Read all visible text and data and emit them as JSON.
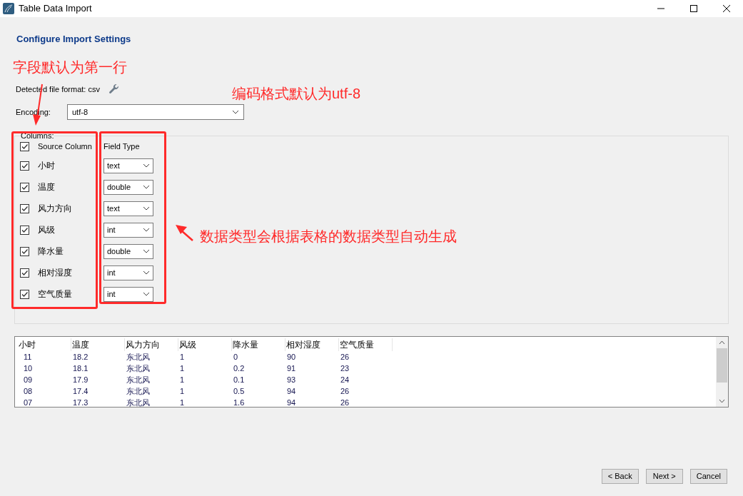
{
  "window": {
    "title": "Table Data Import"
  },
  "heading": "Configure Import Settings",
  "detected_format": "Detected file format: csv",
  "encoding": {
    "label": "Encoding:",
    "value": "utf-8"
  },
  "columns": {
    "legend": "Columns:",
    "header_checked": true,
    "header_source": "Source Column",
    "header_type": "Field Type",
    "items": [
      {
        "name": "小时",
        "checked": true,
        "type": "text"
      },
      {
        "name": "温度",
        "checked": true,
        "type": "double"
      },
      {
        "name": "风力方向",
        "checked": true,
        "type": "text"
      },
      {
        "name": "风级",
        "checked": true,
        "type": "int"
      },
      {
        "name": "降水量",
        "checked": true,
        "type": "double"
      },
      {
        "name": "相对湿度",
        "checked": true,
        "type": "int"
      },
      {
        "name": "空气质量",
        "checked": true,
        "type": "int"
      }
    ]
  },
  "preview": {
    "columns": [
      "小时",
      "温度",
      "风力方向",
      "风级",
      "降水量",
      "相对湿度",
      "空气质量"
    ],
    "rows": [
      [
        "11",
        "18.2",
        "东北风",
        "1",
        "0",
        "90",
        "26"
      ],
      [
        "10",
        "18.1",
        "东北风",
        "1",
        "0.2",
        "91",
        "23"
      ],
      [
        "09",
        "17.9",
        "东北风",
        "1",
        "0.1",
        "93",
        "24"
      ],
      [
        "08",
        "17.4",
        "东北风",
        "1",
        "0.5",
        "94",
        "26"
      ],
      [
        "07",
        "17.3",
        "东北风",
        "1",
        "1.6",
        "94",
        "26"
      ]
    ]
  },
  "buttons": [
    "< Back",
    "Next >",
    "Cancel"
  ],
  "annotations": [
    {
      "kind": "note",
      "text": "字段默认为第一行"
    },
    {
      "kind": "note",
      "text": "编码格式默认为utf-8"
    },
    {
      "kind": "note",
      "text": "数据类型会根据表格的数据类型自动生成"
    }
  ]
}
